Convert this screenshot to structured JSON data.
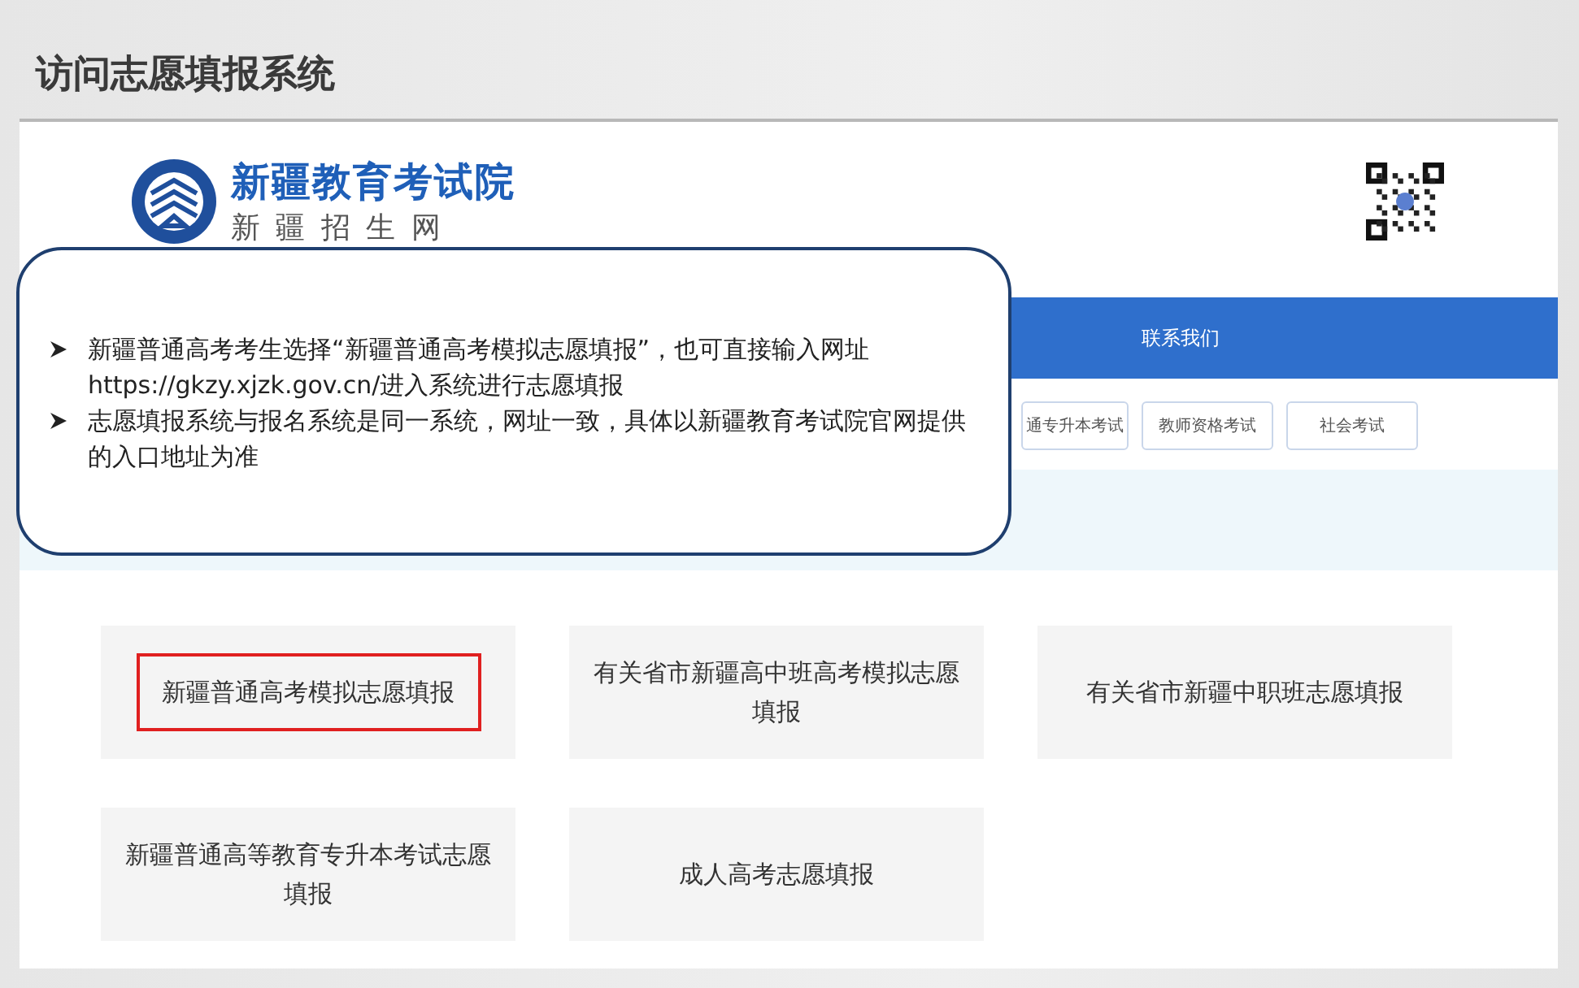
{
  "slide_title": "访问志愿填报系统",
  "site": {
    "name": "新疆教育考试院",
    "subtitle": "新 疆 招 生 网"
  },
  "nav": {
    "items": [
      "联系我们"
    ]
  },
  "exam_buttons": [
    "通专升本考试",
    "教师资格考试",
    "社会考试"
  ],
  "cards": [
    {
      "label": "新疆普通高考模拟志愿填报",
      "highlighted": true
    },
    {
      "label": "有关省市新疆高中班高考模拟志愿填报",
      "highlighted": false
    },
    {
      "label": "有关省市新疆中职班志愿填报",
      "highlighted": false
    },
    {
      "label": "新疆普通高等教育专升本考试志愿填报",
      "highlighted": false
    },
    {
      "label": "成人高考志愿填报",
      "highlighted": false
    }
  ],
  "callout": {
    "bullets": [
      "新疆普通高考考生选择“新疆普通高考模拟志愿填报”，也可直接输入网址https://gkzy.xjzk.gov.cn/进入系统进行志愿填报",
      "志愿填报系统与报名系统是同一系统，网址一致，具体以新疆教育考试院官网提供的入口地址为准"
    ]
  }
}
